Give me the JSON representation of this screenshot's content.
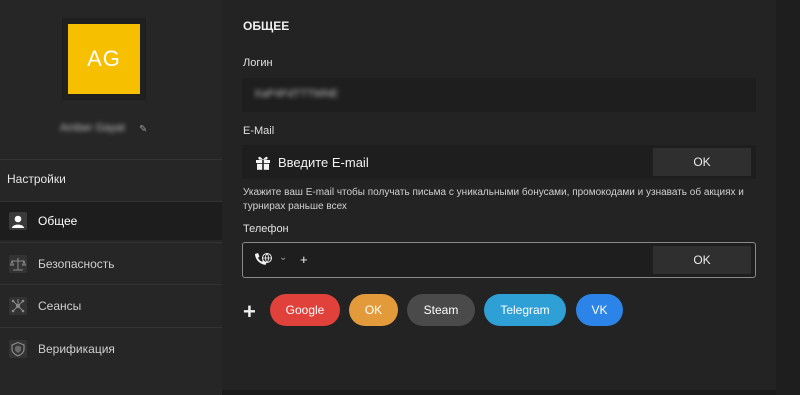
{
  "profile": {
    "avatar_initials": "AG",
    "avatar_color": "#f6bf00",
    "username": "Amber Gayat"
  },
  "sidebar": {
    "section_title": "Настройки",
    "items": [
      {
        "label": "Общее",
        "icon": "user-icon",
        "active": true
      },
      {
        "label": "Безопасность",
        "icon": "scales-icon",
        "active": false
      },
      {
        "label": "Сеансы",
        "icon": "network-icon",
        "active": false
      },
      {
        "label": "Верификация",
        "icon": "shield-icon",
        "active": false
      }
    ]
  },
  "main": {
    "section_title": "ОБЩЕЕ",
    "login": {
      "label": "Логин",
      "value": "XaP4FdTTTMNE"
    },
    "email": {
      "label": "E-Mail",
      "placeholder": "Введите E-mail",
      "ok_label": "OK",
      "hint": "Укажите ваш E-mail чтобы получать письма с уникальными бонусами, промокодами и узнавать об акциях и турнирах раньше всех"
    },
    "phone": {
      "label": "Телефон",
      "prefix": "+",
      "ok_label": "OK"
    },
    "social": {
      "add_icon": "plus-icon",
      "buttons": [
        {
          "label": "Google",
          "color": "#e0413a"
        },
        {
          "label": "OK",
          "color": "#e39a3a"
        },
        {
          "label": "Steam",
          "color": "#4a4a4a"
        },
        {
          "label": "Telegram",
          "color": "#2ea0d6"
        },
        {
          "label": "VK",
          "color": "#2c84e8"
        }
      ]
    }
  }
}
